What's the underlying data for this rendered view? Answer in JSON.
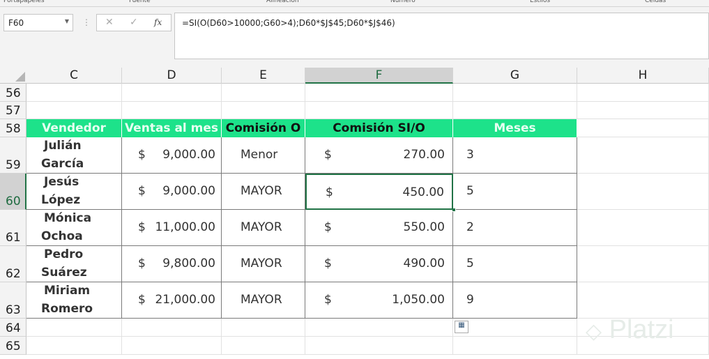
{
  "ribbon": {
    "groups": [
      "Portapapeles",
      "Fuente",
      "Alineación",
      "Número",
      "Estilos",
      "Celdas"
    ]
  },
  "name_box": "F60",
  "formula": "=SI(O(D60>10000;G60>4);D60*$J$45;D60*$J$46)",
  "formula_buttons": {
    "cancel": "✕",
    "enter": "✓",
    "fx": "fx"
  },
  "columns": [
    "C",
    "D",
    "E",
    "F",
    "G",
    "H"
  ],
  "selected_column": "F",
  "rows": [
    "56",
    "57",
    "58",
    "59",
    "60",
    "61",
    "62",
    "63",
    "64",
    "65"
  ],
  "selected_row": "60",
  "table": {
    "headers": [
      {
        "text": "Vendedor",
        "color": "#e6fff1"
      },
      {
        "text": "Ventas al mes",
        "color": "#e6fff1"
      },
      {
        "text": "Comisión O",
        "color": "#111111"
      },
      {
        "text": "Comisión SI/O",
        "color": "#111111"
      },
      {
        "text": "Meses",
        "color": "#e6fff1"
      }
    ],
    "header_bg": "#1de28a",
    "data": [
      {
        "first": "Julián",
        "last": "García",
        "ventas": "9,000.00",
        "comision_o": "Menor",
        "comision_sio": "270.00",
        "meses": "3"
      },
      {
        "first": "Jesús",
        "last": "López",
        "ventas": "9,000.00",
        "comision_o": "MAYOR",
        "comision_sio": "450.00",
        "meses": "5"
      },
      {
        "first": "Mónica",
        "last": "Ochoa",
        "ventas": "11,000.00",
        "comision_o": "MAYOR",
        "comision_sio": "550.00",
        "meses": "2"
      },
      {
        "first": "Pedro",
        "last": "Suárez",
        "ventas": "9,800.00",
        "comision_o": "MAYOR",
        "comision_sio": "490.00",
        "meses": "5"
      },
      {
        "first": "Miriam",
        "last": "Romero",
        "ventas": "21,000.00",
        "comision_o": "MAYOR",
        "comision_sio": "1,050.00",
        "meses": "9"
      }
    ],
    "currency": "$"
  },
  "watermark": "Platzi"
}
